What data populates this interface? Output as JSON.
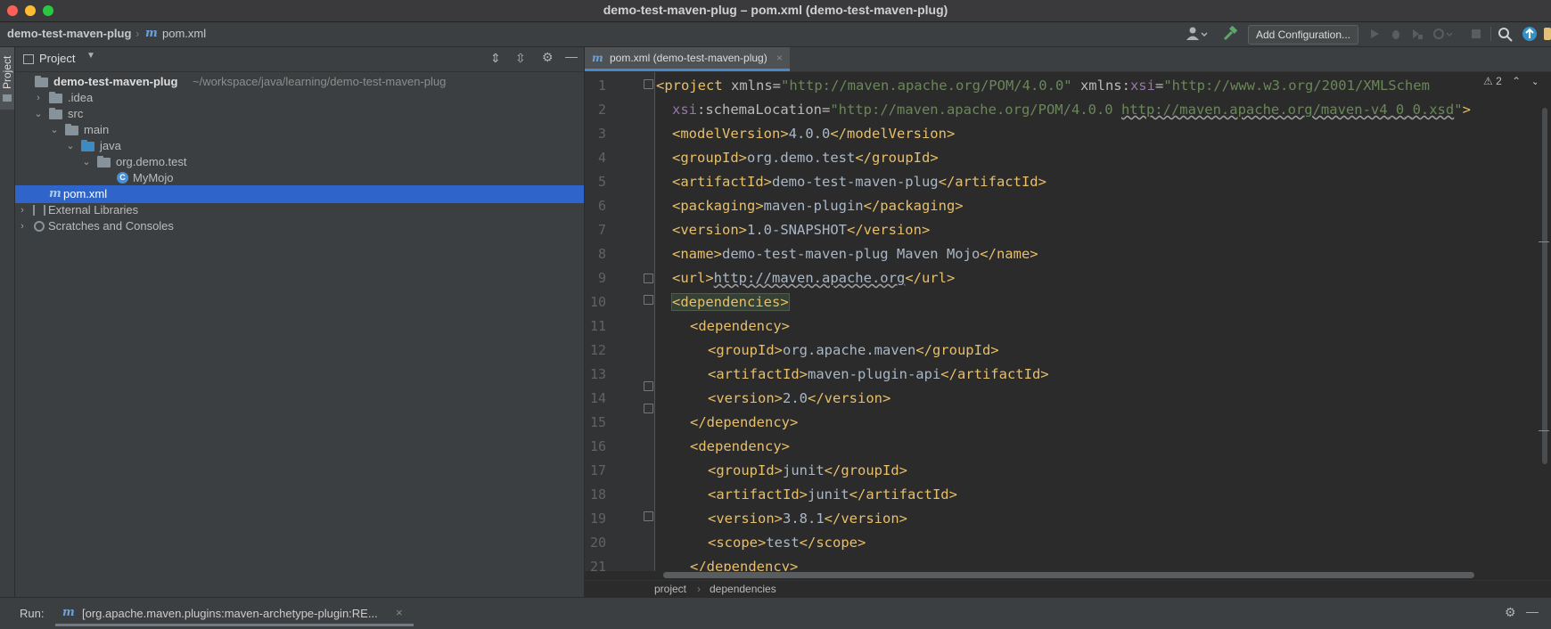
{
  "window": {
    "title": "demo-test-maven-plug – pom.xml (demo-test-maven-plug)"
  },
  "navbar": {
    "breadcrumb_project": "demo-test-maven-plug",
    "breadcrumb_file": "pom.xml",
    "add_configuration": "Add Configuration..."
  },
  "side_tab": {
    "label": "Project"
  },
  "project_panel": {
    "title": "Project",
    "tree": [
      {
        "label": "demo-test-maven-plug",
        "path": "~/workspace/java/learning/demo-test-maven-plug"
      },
      {
        "label": ".idea"
      },
      {
        "label": "src"
      },
      {
        "label": "main"
      },
      {
        "label": "java"
      },
      {
        "label": "org.demo.test"
      },
      {
        "label": "MyMojo",
        "icon": "C"
      },
      {
        "label": "pom.xml",
        "icon": "m"
      },
      {
        "label": "External Libraries"
      },
      {
        "label": "Scratches and Consoles"
      }
    ]
  },
  "editor": {
    "tab_label": "pom.xml (demo-test-maven-plug)",
    "warning_count": "2",
    "line_numbers": [
      "1",
      "2",
      "3",
      "4",
      "5",
      "6",
      "7",
      "8",
      "9",
      "10",
      "11",
      "12",
      "13",
      "14",
      "15",
      "16",
      "17",
      "18",
      "19",
      "20",
      "21"
    ],
    "code": {
      "l1": {
        "tag_open": "<project",
        "attr1": " xmlns",
        "eq": "=",
        "val1": "\"http://maven.apache.org/POM/4.0.0\"",
        "attr2": " xmlns",
        "colon": ":",
        "attr2b": "xsi",
        "val2": "\"http://www.w3.org/2001/XMLSchem"
      },
      "l2": {
        "ns": "xsi",
        "attr": ":schemaLocation",
        "eq": "=",
        "val_a": "\"http://maven.apache.org/POM/4.0.0 ",
        "val_b": "http://maven.apache.org/maven-v4_0_0.xsd",
        "val_c": "\"",
        "close": ">"
      },
      "l3": {
        "o": "<modelVersion>",
        "t": "4.0.0",
        "c": "</modelVersion>"
      },
      "l4": {
        "o": "<groupId>",
        "t": "org.demo.test",
        "c": "</groupId>"
      },
      "l5": {
        "o": "<artifactId>",
        "t": "demo-test-maven-plug",
        "c": "</artifactId>"
      },
      "l6": {
        "o": "<packaging>",
        "t": "maven-plugin",
        "c": "</packaging>"
      },
      "l7": {
        "o": "<version>",
        "t": "1.0-SNAPSHOT",
        "c": "</version>"
      },
      "l8": {
        "o": "<name>",
        "t": "demo-test-maven-plug Maven Mojo",
        "c": "</name>"
      },
      "l9": {
        "o": "<url>",
        "t": "http://maven.apache.org",
        "c": "</url>"
      },
      "l10": "<dependencies>",
      "l11": "<dependency>",
      "l12": {
        "o": "<groupId>",
        "t": "org.apache.maven",
        "c": "</groupId>"
      },
      "l13": {
        "o": "<artifactId>",
        "t": "maven-plugin-api",
        "c": "</artifactId>"
      },
      "l14": {
        "o": "<version>",
        "t": "2.0",
        "c": "</version>"
      },
      "l15": "</dependency>",
      "l16": "<dependency>",
      "l17": {
        "o": "<groupId>",
        "t": "junit",
        "c": "</groupId>"
      },
      "l18": {
        "o": "<artifactId>",
        "t": "junit",
        "c": "</artifactId>"
      },
      "l19": {
        "o": "<version>",
        "t": "3.8.1",
        "c": "</version>"
      },
      "l20": {
        "o": "<scope>",
        "t": "test",
        "c": "</scope>"
      },
      "l21": "</dependency>"
    },
    "breadcrumb": [
      "project",
      "dependencies"
    ],
    "breadcrumb_sep": "›"
  },
  "run_bar": {
    "label": "Run:",
    "tab_text": "[org.apache.maven.plugins:maven-archetype-plugin:RE...",
    "close_glyph": "×"
  },
  "colors": {
    "selection": "#2f65ca",
    "tag": "#e8bf6a",
    "attr_value": "#6a8759",
    "namespace": "#9876aa"
  }
}
